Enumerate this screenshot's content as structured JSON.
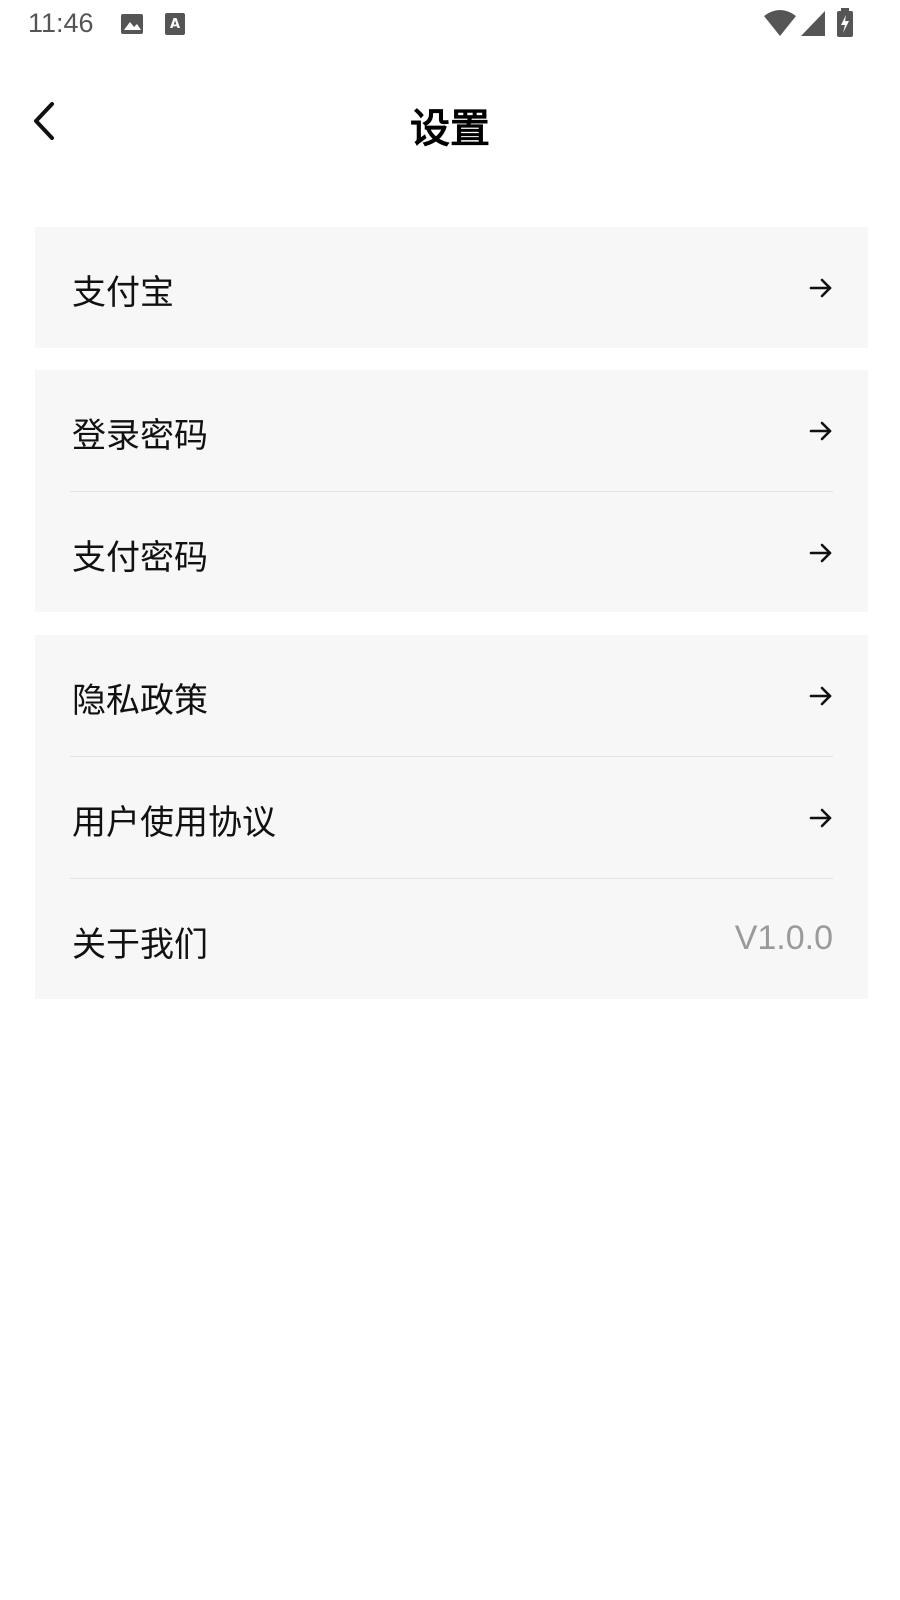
{
  "status_bar": {
    "time": "11:46",
    "icons": [
      "image-icon",
      "text-a-icon",
      "wifi-icon",
      "signal-icon",
      "battery-charging-icon"
    ]
  },
  "header": {
    "title": "设置",
    "back_icon": "chevron-left-icon"
  },
  "groups": [
    {
      "items": [
        {
          "label": "支付宝",
          "trailing": "arrow-right-icon"
        }
      ]
    },
    {
      "items": [
        {
          "label": "登录密码",
          "trailing": "arrow-right-icon"
        },
        {
          "label": "支付密码",
          "trailing": "arrow-right-icon"
        }
      ]
    },
    {
      "items": [
        {
          "label": "隐私政策",
          "trailing": "arrow-right-icon"
        },
        {
          "label": "用户使用协议",
          "trailing": "arrow-right-icon"
        },
        {
          "label": "关于我们",
          "value": "V1.0.0"
        }
      ]
    }
  ],
  "colors": {
    "group_background": "#f7f7f7",
    "divider": "#e4e4e4",
    "value_text": "#9a9a9a"
  }
}
